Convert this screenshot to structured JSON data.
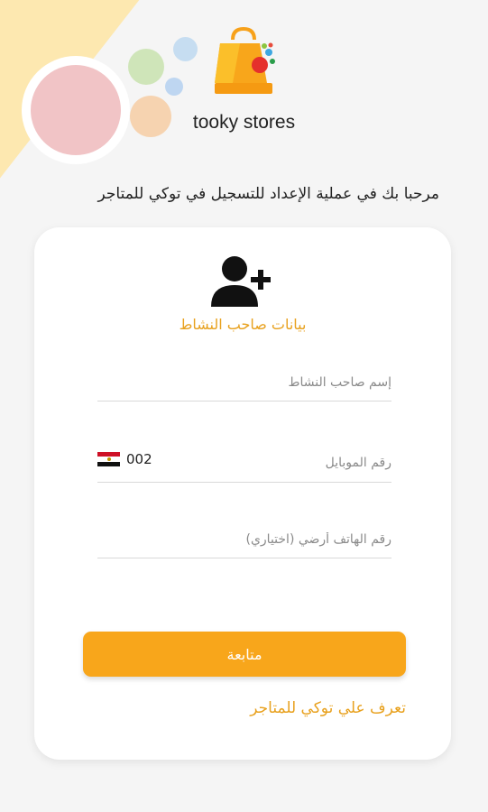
{
  "header": {
    "brand_name": "tooky stores",
    "welcome_text": "مرحبا بك في عملية الإعداد للتسجيل في توكي للمتاجر"
  },
  "card": {
    "section_title": "بيانات صاحب النشاط",
    "fields": {
      "owner_name": {
        "placeholder": "إسم صاحب النشاط",
        "value": ""
      },
      "mobile": {
        "placeholder": "رقم الموبايل",
        "value": "",
        "country_code": "002",
        "country_flag": "egypt-flag"
      },
      "landline": {
        "placeholder": "رقم الهاتف أرضي (اختياري)",
        "value": ""
      }
    },
    "continue_label": "متابعة",
    "learn_more_label": "تعرف علي توكي للمتاجر"
  },
  "colors": {
    "accent": "#f8a61b",
    "accent_text": "#e8a11e",
    "background": "#f5f5f5",
    "card": "#ffffff"
  },
  "icons": {
    "logo": "shopping-bag-logo-icon",
    "section": "add-user-icon"
  }
}
